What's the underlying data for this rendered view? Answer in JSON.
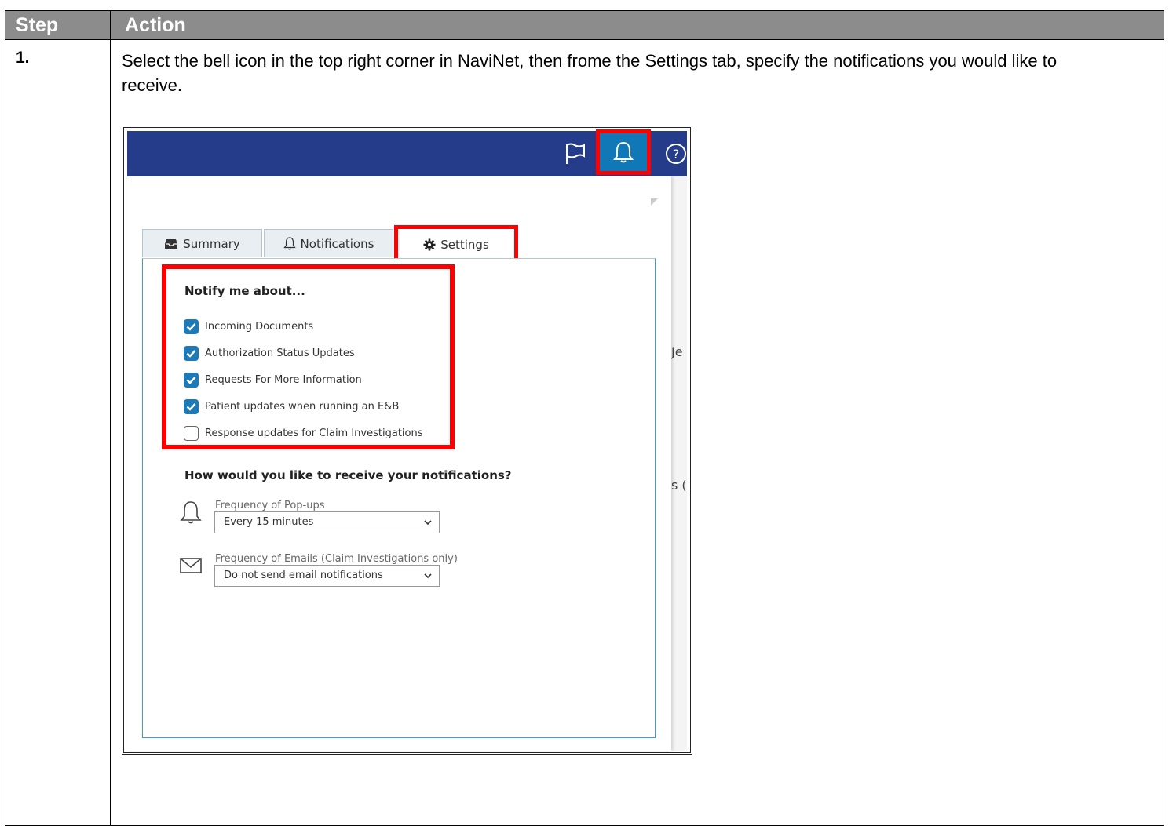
{
  "table": {
    "header_step": "Step",
    "header_action": "Action",
    "row1_step": "1.",
    "row1_instruction": "Select the bell icon in the top right corner in NaviNet, then frome the Settings tab, specify the notifications you would like to receive."
  },
  "screenshot": {
    "topbar_icons": [
      "flag-icon",
      "bell-icon",
      "help-icon"
    ],
    "tabs": [
      {
        "label": "Summary",
        "icon": "inbox-icon"
      },
      {
        "label": "Notifications",
        "icon": "bell-icon"
      },
      {
        "label": "Settings",
        "icon": "gear-icon",
        "active": true
      }
    ],
    "notify_title": "Notify me about...",
    "options": [
      {
        "label": "Incoming Documents",
        "checked": true
      },
      {
        "label": "Authorization Status Updates",
        "checked": true
      },
      {
        "label": "Requests For More Information",
        "checked": true
      },
      {
        "label": "Patient updates when running an E&B",
        "checked": true
      },
      {
        "label": "Response updates for Claim Investigations",
        "checked": false
      }
    ],
    "receive_title": "How would you like to receive your notifications?",
    "popup_label": "Frequency of Pop-ups",
    "popup_value": "Every 15 minutes",
    "email_label": "Frequency of Emails (Claim Investigations only)",
    "email_value": "Do not send email notifications",
    "side_fragment_1": "Je",
    "side_fragment_2": "s ("
  },
  "colors": {
    "header_bg": "#8c8c8c",
    "topbar": "#243c8a",
    "bell_active": "#1178b8",
    "highlight": "#ff0000",
    "checkbox_on": "#1c7ab8"
  }
}
